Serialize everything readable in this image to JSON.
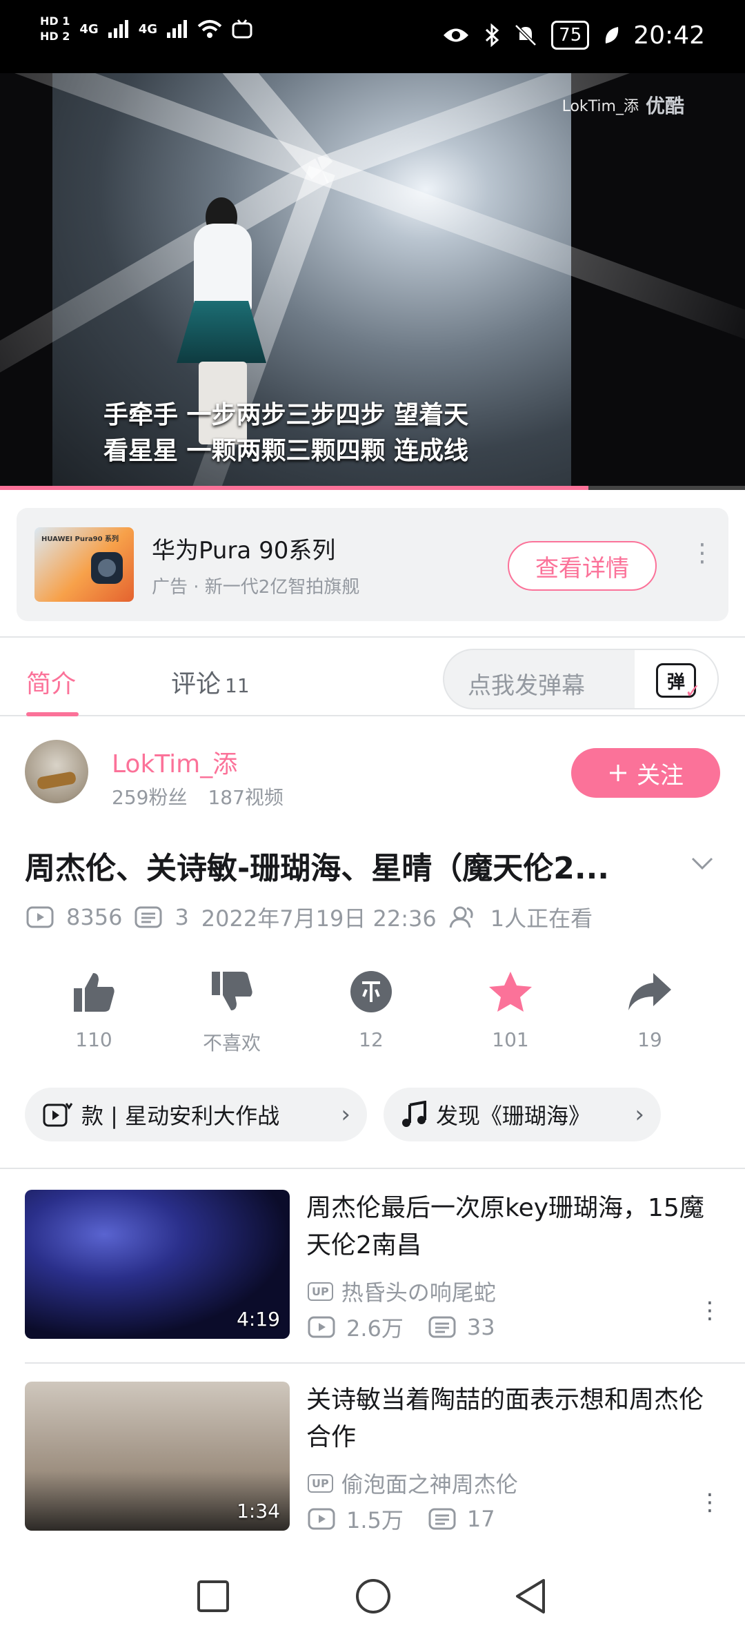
{
  "status_bar": {
    "hd1": "HD 1",
    "hd2": "HD 2",
    "net1": "4G",
    "net2": "4G",
    "battery": "75",
    "time": "20:42"
  },
  "video": {
    "lyrics_line1": "手牵手  一步两步三步四步  望着天",
    "lyrics_line2": "看星星  一颗两颗三颗四颗  连成线",
    "watermark_user": "LokTim_添",
    "watermark_logo": "优酷",
    "progress_fraction": 0.79
  },
  "ad": {
    "thumb_text": "HUAWEI Pura90 系列",
    "title": "华为Pura 90系列",
    "subtitle": "广告 · 新一代2亿智拍旗舰",
    "button": "查看详情",
    "more": "⋮"
  },
  "tabs": {
    "intro": "简介",
    "comments": "评论",
    "comments_count": "11",
    "danmaku_placeholder": "点我发弹幕",
    "danmaku_icon_text": "弹"
  },
  "uploader": {
    "name": "LokTim_添",
    "followers": "259粉丝",
    "videos": "187视频",
    "follow_button": "关注"
  },
  "video_info": {
    "title": "周杰伦、关诗敏-珊瑚海、星晴（魔天伦2...",
    "views": "8356",
    "danmaku_count": "3",
    "date": "2022年7月19日 22:36",
    "watching": "1人正在看"
  },
  "actions": [
    {
      "label": "110",
      "icon": "like-icon"
    },
    {
      "label": "不喜欢",
      "icon": "dislike-icon"
    },
    {
      "label": "12",
      "icon": "coin-icon"
    },
    {
      "label": "101",
      "icon": "favorite-star-icon"
    },
    {
      "label": "19",
      "icon": "share-icon"
    }
  ],
  "chips": {
    "chip1": "款 | 星动安利大作战",
    "chip2": "发现《珊瑚海》"
  },
  "recommendations": [
    {
      "title": "周杰伦最后一次原key珊瑚海，15魔天伦2南昌",
      "uploader": "热昏头の响尾蛇",
      "views": "2.6万",
      "danmaku": "33",
      "duration": "4:19"
    },
    {
      "title": "关诗敏当着陶喆的面表示想和周杰伦合作",
      "uploader": "偷泡面之神周杰伦",
      "views": "1.5万",
      "danmaku": "17",
      "duration": "1:34"
    }
  ],
  "colors": {
    "accent": "#fb7299",
    "secondary_text": "#9499a0",
    "icon_dark": "#61666d"
  }
}
